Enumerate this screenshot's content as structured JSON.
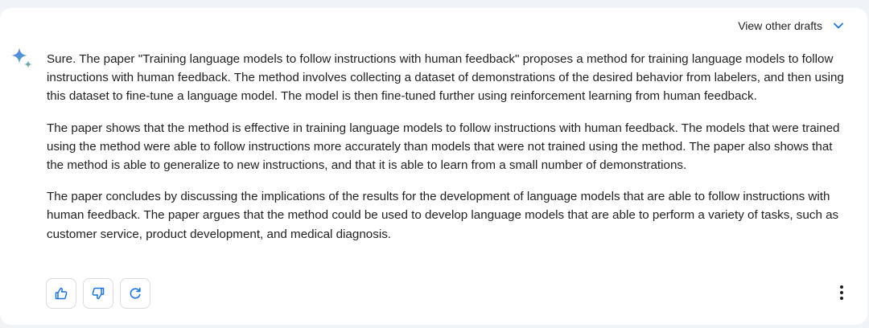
{
  "header": {
    "drafts_label": "View other drafts",
    "drafts_icon": "chevron-down-icon"
  },
  "assistant_icon": "sparkle-icon",
  "response": {
    "paragraphs": [
      "Sure. The paper \"Training language models to follow instructions with human feedback\" proposes a method for training language models to follow instructions with human feedback. The method involves collecting a dataset of demonstrations of the desired behavior from labelers, and then using this dataset to fine-tune a language model. The model is then fine-tuned further using reinforcement learning from human feedback.",
      "The paper shows that the method is effective in training language models to follow instructions with human feedback. The models that were trained using the method were able to follow instructions more accurately than models that were not trained using the method. The paper also shows that the method is able to generalize to new instructions, and that it is able to learn from a small number of demonstrations.",
      "The paper concludes by discussing the implications of the results for the development of language models that are able to follow instructions with human feedback. The paper argues that the method could be used to develop language models that are able to perform a variety of tasks, such as customer service, product development, and medical diagnosis."
    ]
  },
  "actions": {
    "buttons": [
      "thumbs-up-icon",
      "thumbs-down-icon",
      "regenerate-icon"
    ],
    "more_icon": "more-vert-icon"
  },
  "colors": {
    "page_background": "#f0f4f9",
    "card_background": "#ffffff",
    "text": "#1f1f1f",
    "accent_blue": "#1a73e8",
    "icon": "#1f1f1f",
    "border": "#dadce0"
  }
}
